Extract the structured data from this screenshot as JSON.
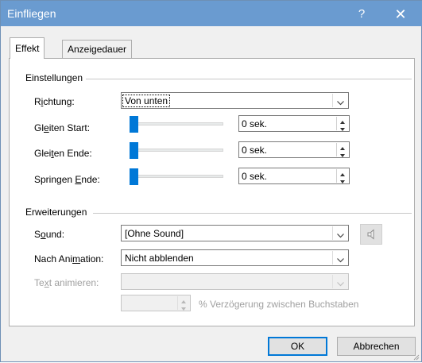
{
  "window": {
    "title": "Einfliegen",
    "help_glyph": "?",
    "close_glyph": "✕"
  },
  "tabs": [
    {
      "label": "Effekt",
      "active": true
    },
    {
      "label": "Anzeigedauer",
      "active": false
    }
  ],
  "einstellungen": {
    "title": "Einstellungen",
    "richtung": {
      "label_pre": "R",
      "label_u": "i",
      "label_post": "chtung:",
      "value": "Von unten"
    },
    "gleiten_start": {
      "label_pre": "Gl",
      "label_u": "e",
      "label_post": "iten Start:",
      "value": "0 sek.",
      "level": 0
    },
    "gleiten_ende": {
      "label_pre": "Glei",
      "label_u": "t",
      "label_post": "en Ende:",
      "value": "0 sek.",
      "level": 0
    },
    "springen_ende": {
      "label_pre": "Springen ",
      "label_u": "E",
      "label_post": "nde:",
      "value": "0 sek.",
      "level": 0
    }
  },
  "erweiterungen": {
    "title": "Erweiterungen",
    "sound": {
      "label_pre": "S",
      "label_u": "o",
      "label_post": "und:",
      "value": "[Ohne Sound]"
    },
    "nach_animation": {
      "label_pre": "Nach Ani",
      "label_u": "m",
      "label_post": "ation:",
      "value": "Nicht abblenden"
    },
    "text_animieren": {
      "label_pre": "Te",
      "label_u": "x",
      "label_post": "t animieren:",
      "value": ""
    },
    "verzoegerung": {
      "value": "",
      "label": "% Verzögerung zwischen Buchstaben"
    }
  },
  "buttons": {
    "ok": "OK",
    "cancel": "Abbrechen"
  },
  "colors": {
    "titlebar": "#6a9bd0",
    "accent": "#0078d7",
    "disabled_text": "#a0a0a0"
  }
}
